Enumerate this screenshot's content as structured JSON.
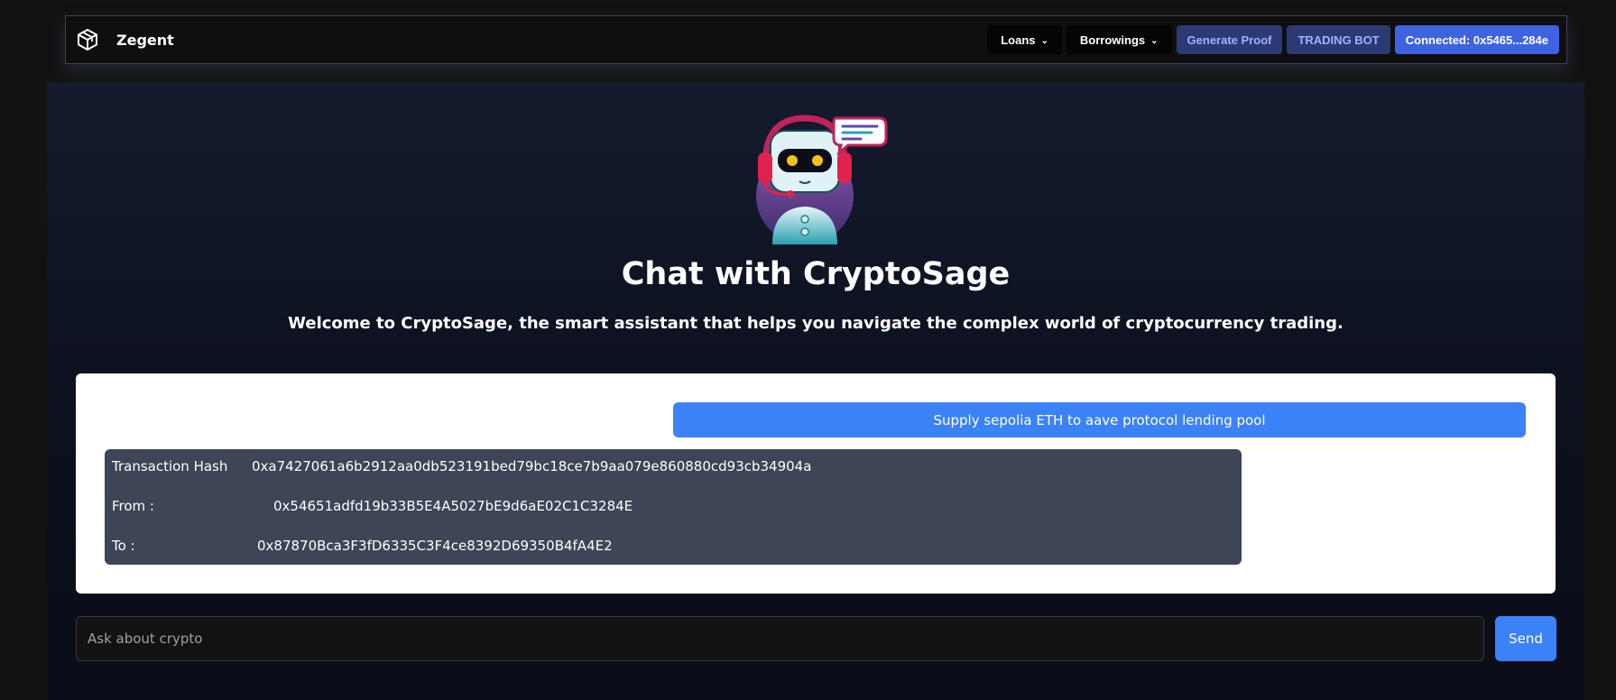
{
  "navbar": {
    "brand_name": "Zegent",
    "logo_icon": "cube-icon",
    "loans_label": "Loans",
    "borrowings_label": "Borrowings",
    "generate_proof_label": "Generate Proof",
    "trading_bot_label": "TRADING BOT",
    "connected_label": "Connected: 0x5465...284e"
  },
  "hero": {
    "avatar_icon": "chatbot-robot-icon",
    "title": "Chat with CryptoSage",
    "subtitle": "Welcome to CryptoSage, the smart assistant that helps you navigate the complex world of cryptocurrency trading."
  },
  "chat": {
    "user_message": "Supply sepolia ETH to aave protocol lending pool",
    "transaction": {
      "hash_label": "Transaction Hash",
      "hash_value": "0xa7427061a6b2912aa0db523191bed79bc18ce7b9aa079e860880cd93cb34904a",
      "from_label": "From :",
      "from_value": "0x54651adfd19b33B5E4A5027bE9d6aE02C1C3284E",
      "to_label": "To :",
      "to_value": "0x87870Bca3F3fD6335C3F4ce8392D69350B4fA4E2"
    }
  },
  "composer": {
    "placeholder": "Ask about crypto",
    "value": "",
    "send_label": "Send"
  },
  "colors": {
    "accent": "#3b82f6",
    "connect_button": "#3e63df",
    "proof_button_bg": "#2b3a73",
    "proof_button_text": "#9db2ff",
    "tx_box": "#3d4556"
  }
}
